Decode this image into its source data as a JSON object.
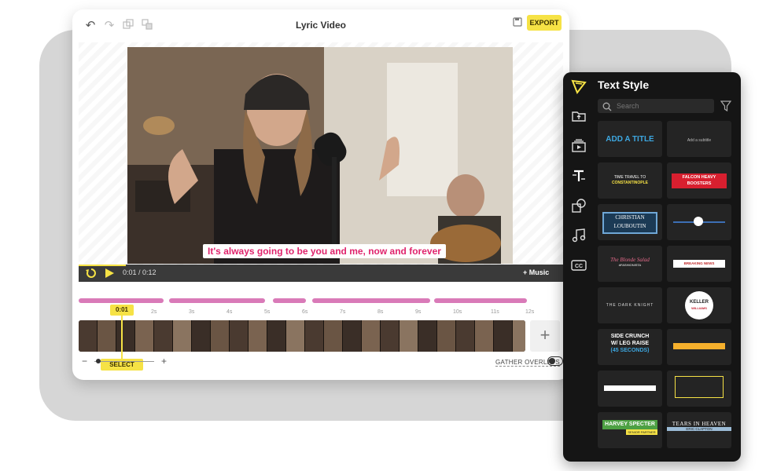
{
  "editor": {
    "title": "Lyric Video",
    "export_label": "EXPORT",
    "lyric_text": "It's always going to be you and me, now and forever",
    "time_current": "0:01",
    "time_total": "0:12",
    "time_display": "0:01 / 0:12",
    "music_label": "+ Music",
    "playhead_time": "0:01",
    "select_label": "SELECT",
    "gather_overlays_label": "GATHER OVERLAYS",
    "add_clip_label": "+",
    "zoom_minus": "−",
    "zoom_plus": "+",
    "ruler_labels": [
      "1s",
      "2s",
      "3s",
      "4s",
      "5s",
      "6s",
      "7s",
      "8s",
      "9s",
      "10s",
      "11s",
      "12s"
    ]
  },
  "text_style_panel": {
    "title": "Text Style",
    "search_placeholder": "Search",
    "tiles": {
      "add_title": "ADD A TITLE",
      "add_subtitle": "Add a subtitle",
      "time_travel_line1": "TIME TRAVEL TO",
      "time_travel_line2": "CONSTANTINOPLE",
      "falcon_line1": "FALCON HEAVY",
      "falcon_line2": "BOOSTERS",
      "christian_line1": "CHRISTIAN",
      "christian_line2": "LOUBOUTIN",
      "blonde_salad": "The Blonde Salad",
      "blonde_salad_sub": "#FASHIONISTA",
      "breaking_news": "BREAKING NEWS",
      "dark_knight": "THE DARK KNIGHT",
      "keller_line1": "KELLER",
      "keller_line2": "WILLIAMS",
      "side_crunch_line1": "SIDE CRUNCH",
      "side_crunch_line2": "W/ LEG RAISE",
      "side_crunch_line3": "(45 SECONDS)",
      "harvey_specter": "HARVEY SPECTER",
      "harvey_sub": "SENIOR PARTNER",
      "tears_in_heaven": "TEARS IN HEAVEN",
      "tears_sub": "ERIC CLAPTON"
    }
  },
  "colors": {
    "accent_yellow": "#f6e245",
    "lyric_pink": "#e0246d",
    "track_pink": "#d97ab8",
    "panel_bg": "#151515"
  }
}
